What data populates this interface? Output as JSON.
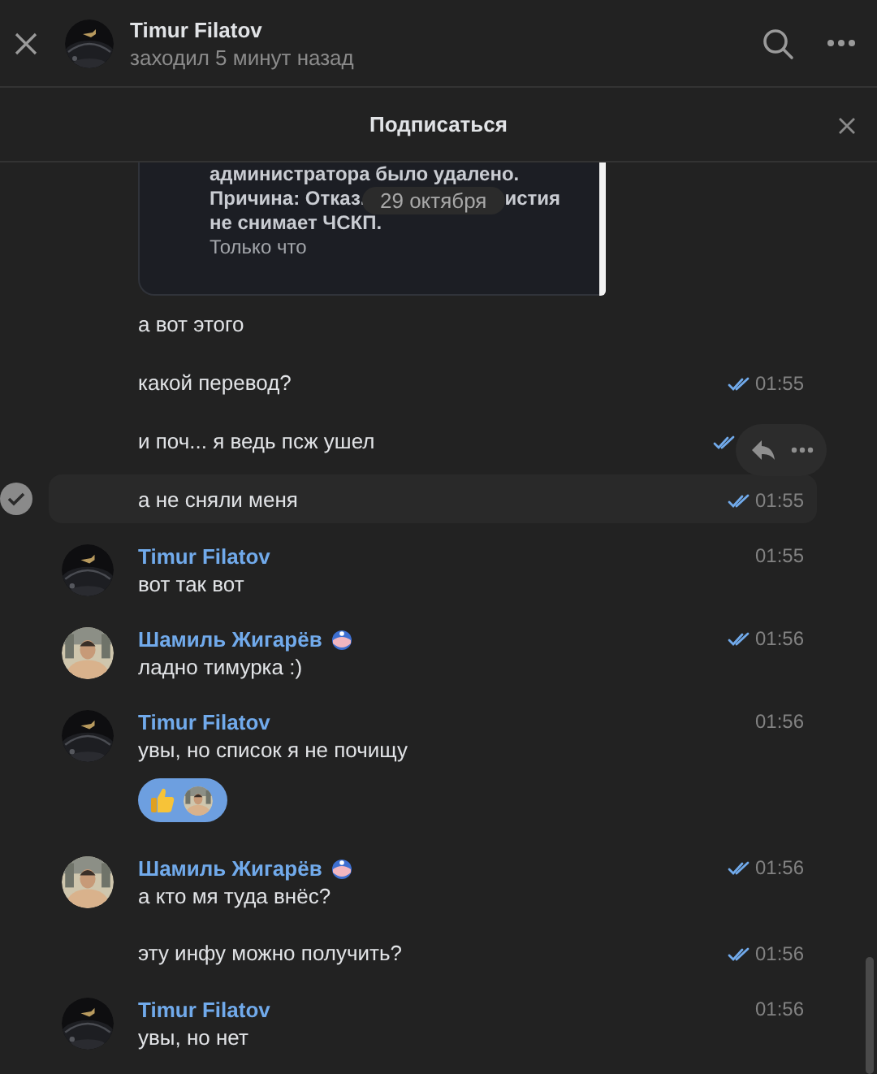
{
  "header": {
    "name": "Timur Filatov",
    "status": "заходил 5 минут назад"
  },
  "banner": {
    "label": "Подписаться"
  },
  "attachment_card": {
    "lines": [
      "администратора было удалено.",
      "Причина: Отказ.",
      "истия",
      "не снимает ЧСКП."
    ],
    "time": "Только что"
  },
  "date_pill": "29 октября",
  "messages": [
    {
      "kind": "plain",
      "text": "а вот этого",
      "read": false,
      "selected": false
    },
    {
      "kind": "plain",
      "text": "какой перевод?",
      "time": "01:55",
      "read": true,
      "selected": false
    },
    {
      "kind": "plain",
      "text": "и поч... я ведь псж ушел",
      "read": true,
      "selected": false
    },
    {
      "kind": "plain",
      "text": "а не сняли меня",
      "time": "01:55",
      "read": true,
      "selected": true
    },
    {
      "kind": "group",
      "author": "Timur Filatov",
      "badge": false,
      "text": "вот так вот",
      "time": "01:55",
      "read": false,
      "selected": false
    },
    {
      "kind": "group",
      "author": "Шамиль Жигарёв",
      "badge": true,
      "text": "ладно тимурка :)",
      "time": "01:56",
      "read": true,
      "selected": false
    },
    {
      "kind": "group",
      "author": "Timur Filatov",
      "badge": false,
      "text": "увы, но список я не почищу",
      "time": "01:56",
      "read": false,
      "selected": false,
      "reactions": [
        {
          "kind": "thumbs_up",
          "selected": true
        }
      ]
    },
    {
      "kind": "group",
      "author": "Шамиль Жигарёв",
      "badge": true,
      "text": "а кто мя туда внёс?",
      "time": "01:56",
      "read": true,
      "selected": false
    },
    {
      "kind": "plain",
      "text": "эту инфу можно получить?",
      "time": "01:56",
      "read": true,
      "selected": false
    },
    {
      "kind": "group",
      "author": "Timur Filatov",
      "badge": false,
      "text": "увы, но нет",
      "time": "01:56",
      "read": false,
      "selected": false
    }
  ]
}
